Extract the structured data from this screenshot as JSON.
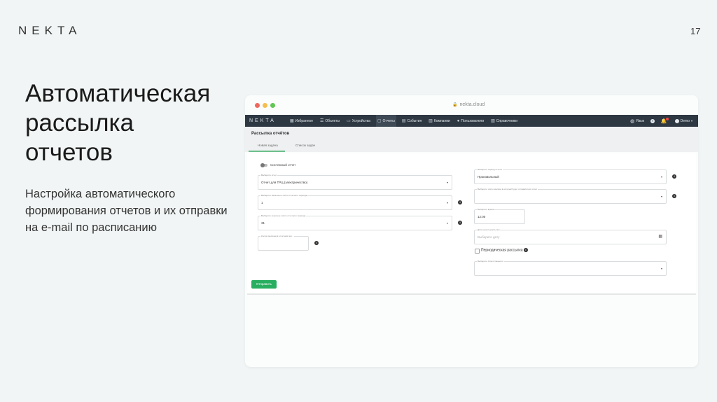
{
  "slide": {
    "logo": "NEKTA",
    "page_number": "17",
    "heading": "Автоматическая\nрассылка\nотчетов",
    "description": "Настройка автоматического формирования отчетов и их отправки на e-mail по расписанию"
  },
  "browser": {
    "url": "nekta.cloud",
    "nav": {
      "logo": "NEKTA",
      "items": [
        {
          "label": "Избранное",
          "icon": "grid-icon",
          "glyph": "▦"
        },
        {
          "label": "Объекты",
          "icon": "list-icon",
          "glyph": "☰"
        },
        {
          "label": "Устройства",
          "icon": "device-icon",
          "glyph": "▭"
        },
        {
          "label": "Отчеты",
          "icon": "report-icon",
          "glyph": "▢"
        },
        {
          "label": "События",
          "icon": "calendar-icon",
          "glyph": "▤"
        },
        {
          "label": "Компании",
          "icon": "company-icon",
          "glyph": "▥"
        },
        {
          "label": "Пользователи",
          "icon": "user-icon",
          "glyph": "●"
        },
        {
          "label": "Справочники",
          "icon": "book-icon",
          "glyph": "▧"
        }
      ],
      "active_index": 3,
      "language": "Язык",
      "user": "Demo"
    },
    "page_title": "Рассылка отчётов",
    "tabs": [
      "Новая задача",
      "Список задач"
    ],
    "active_tab": 0,
    "form": {
      "system_report_label": "Системный отчет",
      "left_fields": [
        {
          "label": "Выберите отчет",
          "value": "Отчет для ТРЦ (электричество)",
          "placeholder": false,
          "has_caret": true,
          "has_info": false
        },
        {
          "label": "Выберите начальное число отчетного периода",
          "value": "1",
          "placeholder": false,
          "has_caret": true,
          "has_info": true
        },
        {
          "label": "Выберите конечное число отчетного периода",
          "value": "31",
          "placeholder": false,
          "has_caret": true,
          "has_info": true
        },
        {
          "label": "Кол-во месяцев в отчетном пер...",
          "value": "",
          "placeholder": false,
          "has_caret": false,
          "has_info": true
        }
      ],
      "right_fields": [
        {
          "label": "Выберите период отчёта",
          "value": "Произвольный",
          "placeholder": false,
          "has_caret": true,
          "has_info": true
        },
        {
          "label": "Выберите число месяца в который будет отправляться отчет",
          "value": "",
          "placeholder": false,
          "has_caret": true,
          "has_info": true
        },
        {
          "label": "Выберите время",
          "value": "12:00",
          "placeholder": false,
          "has_caret": false,
          "has_info": false
        },
        {
          "label": "Дата начала рассылки",
          "value": "Выберите дату",
          "placeholder": true,
          "has_caret": false,
          "has_info": false,
          "calendar": true
        }
      ],
      "periodic_label": "Периодическая рассылка",
      "employee_field": {
        "label": "Выберите Ответственного",
        "value": ""
      },
      "submit_label": "Отправить"
    }
  }
}
